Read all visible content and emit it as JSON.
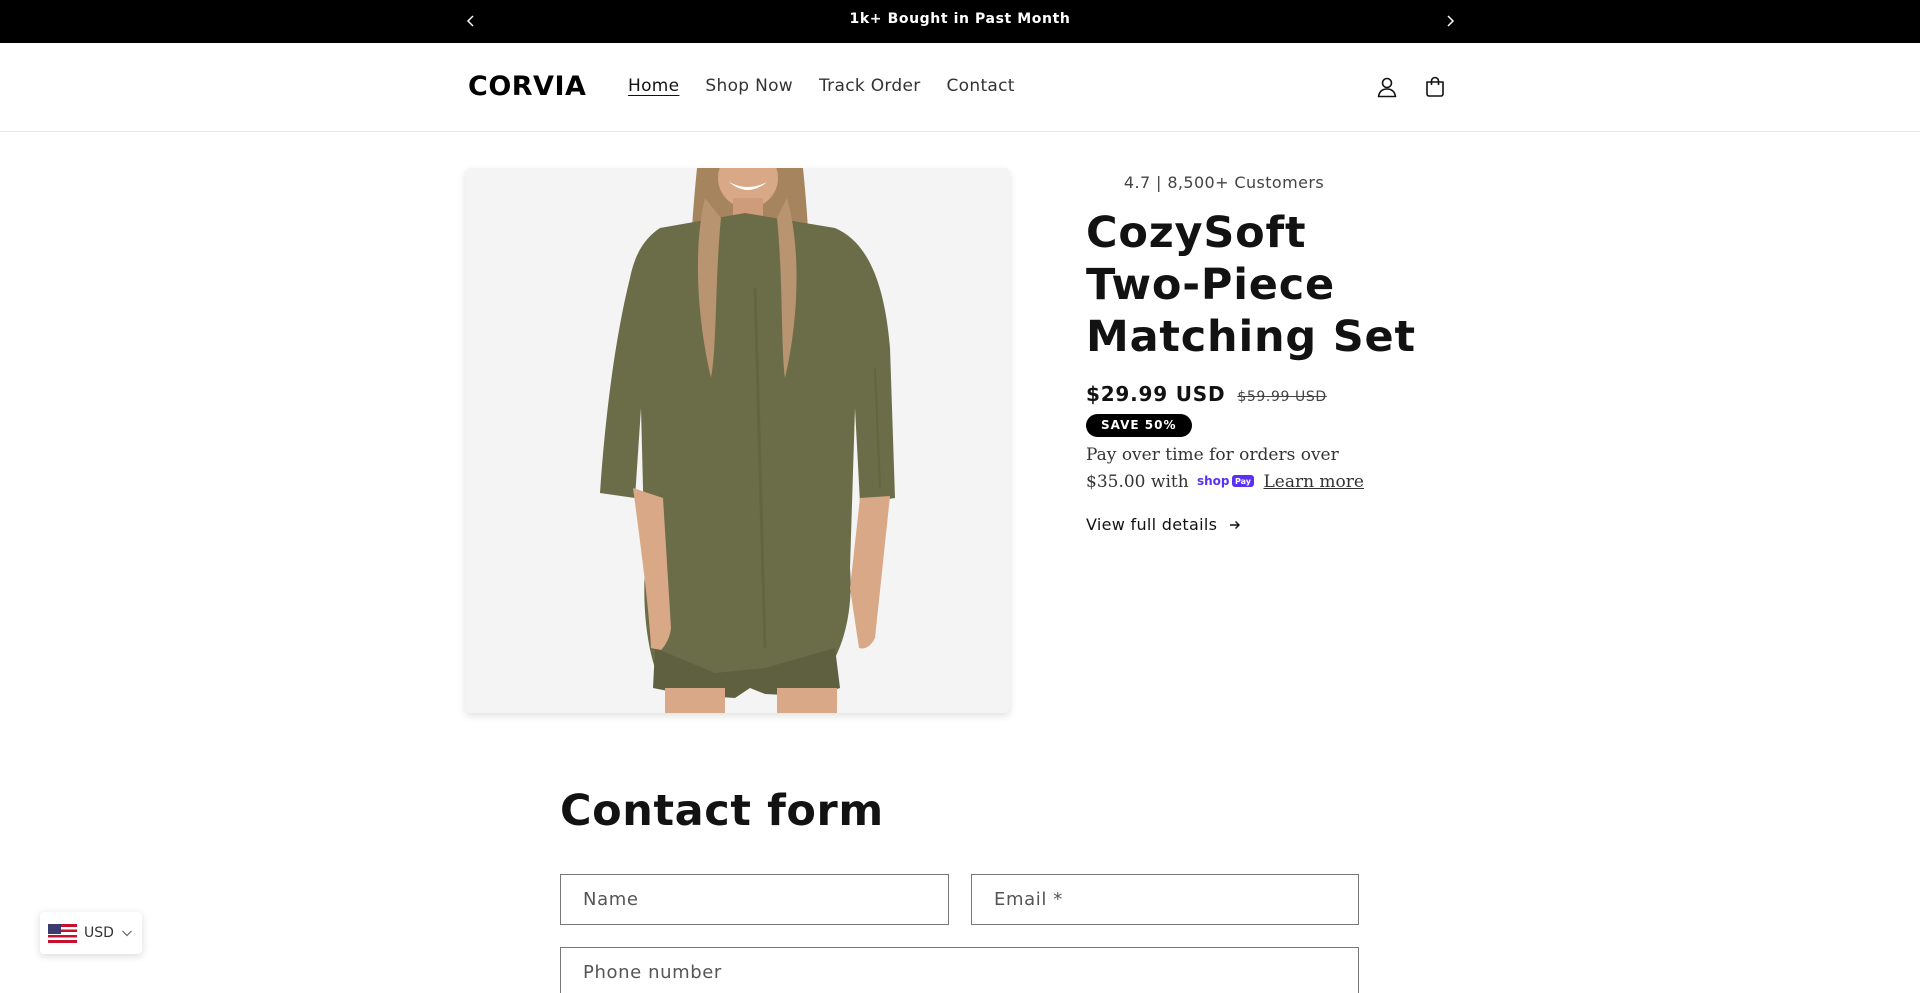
{
  "announcement": {
    "message": "1k+ Bought in Past Month"
  },
  "header": {
    "logo": "CORVIA",
    "nav": [
      {
        "label": "Home",
        "active": true
      },
      {
        "label": "Shop Now",
        "active": false
      },
      {
        "label": "Track Order",
        "active": false
      },
      {
        "label": "Contact",
        "active": false
      }
    ],
    "icons": [
      "account-icon",
      "cart-icon"
    ]
  },
  "product": {
    "rating_text": "4.7 | 8,500+ Customers",
    "title": "CozySoft Two-Piece Matching Set",
    "price": "$29.99 USD",
    "compare_price": "$59.99 USD",
    "badge": "SAVE 50%",
    "installments_prefix": "Pay over time for orders over $35.00 with",
    "installments_link": "Learn more",
    "view_details": "View full details",
    "image_alt_color": "#6b6c48"
  },
  "contact_form": {
    "title": "Contact form",
    "name_placeholder": "Name",
    "email_placeholder": "Email *",
    "phone_placeholder": "Phone number"
  },
  "currency": {
    "code": "USD",
    "flag": "us-flag-icon"
  },
  "colors": {
    "announcement_bg": "#000000",
    "badge_bg": "#000000",
    "shop_pay": "#5a31f4"
  }
}
